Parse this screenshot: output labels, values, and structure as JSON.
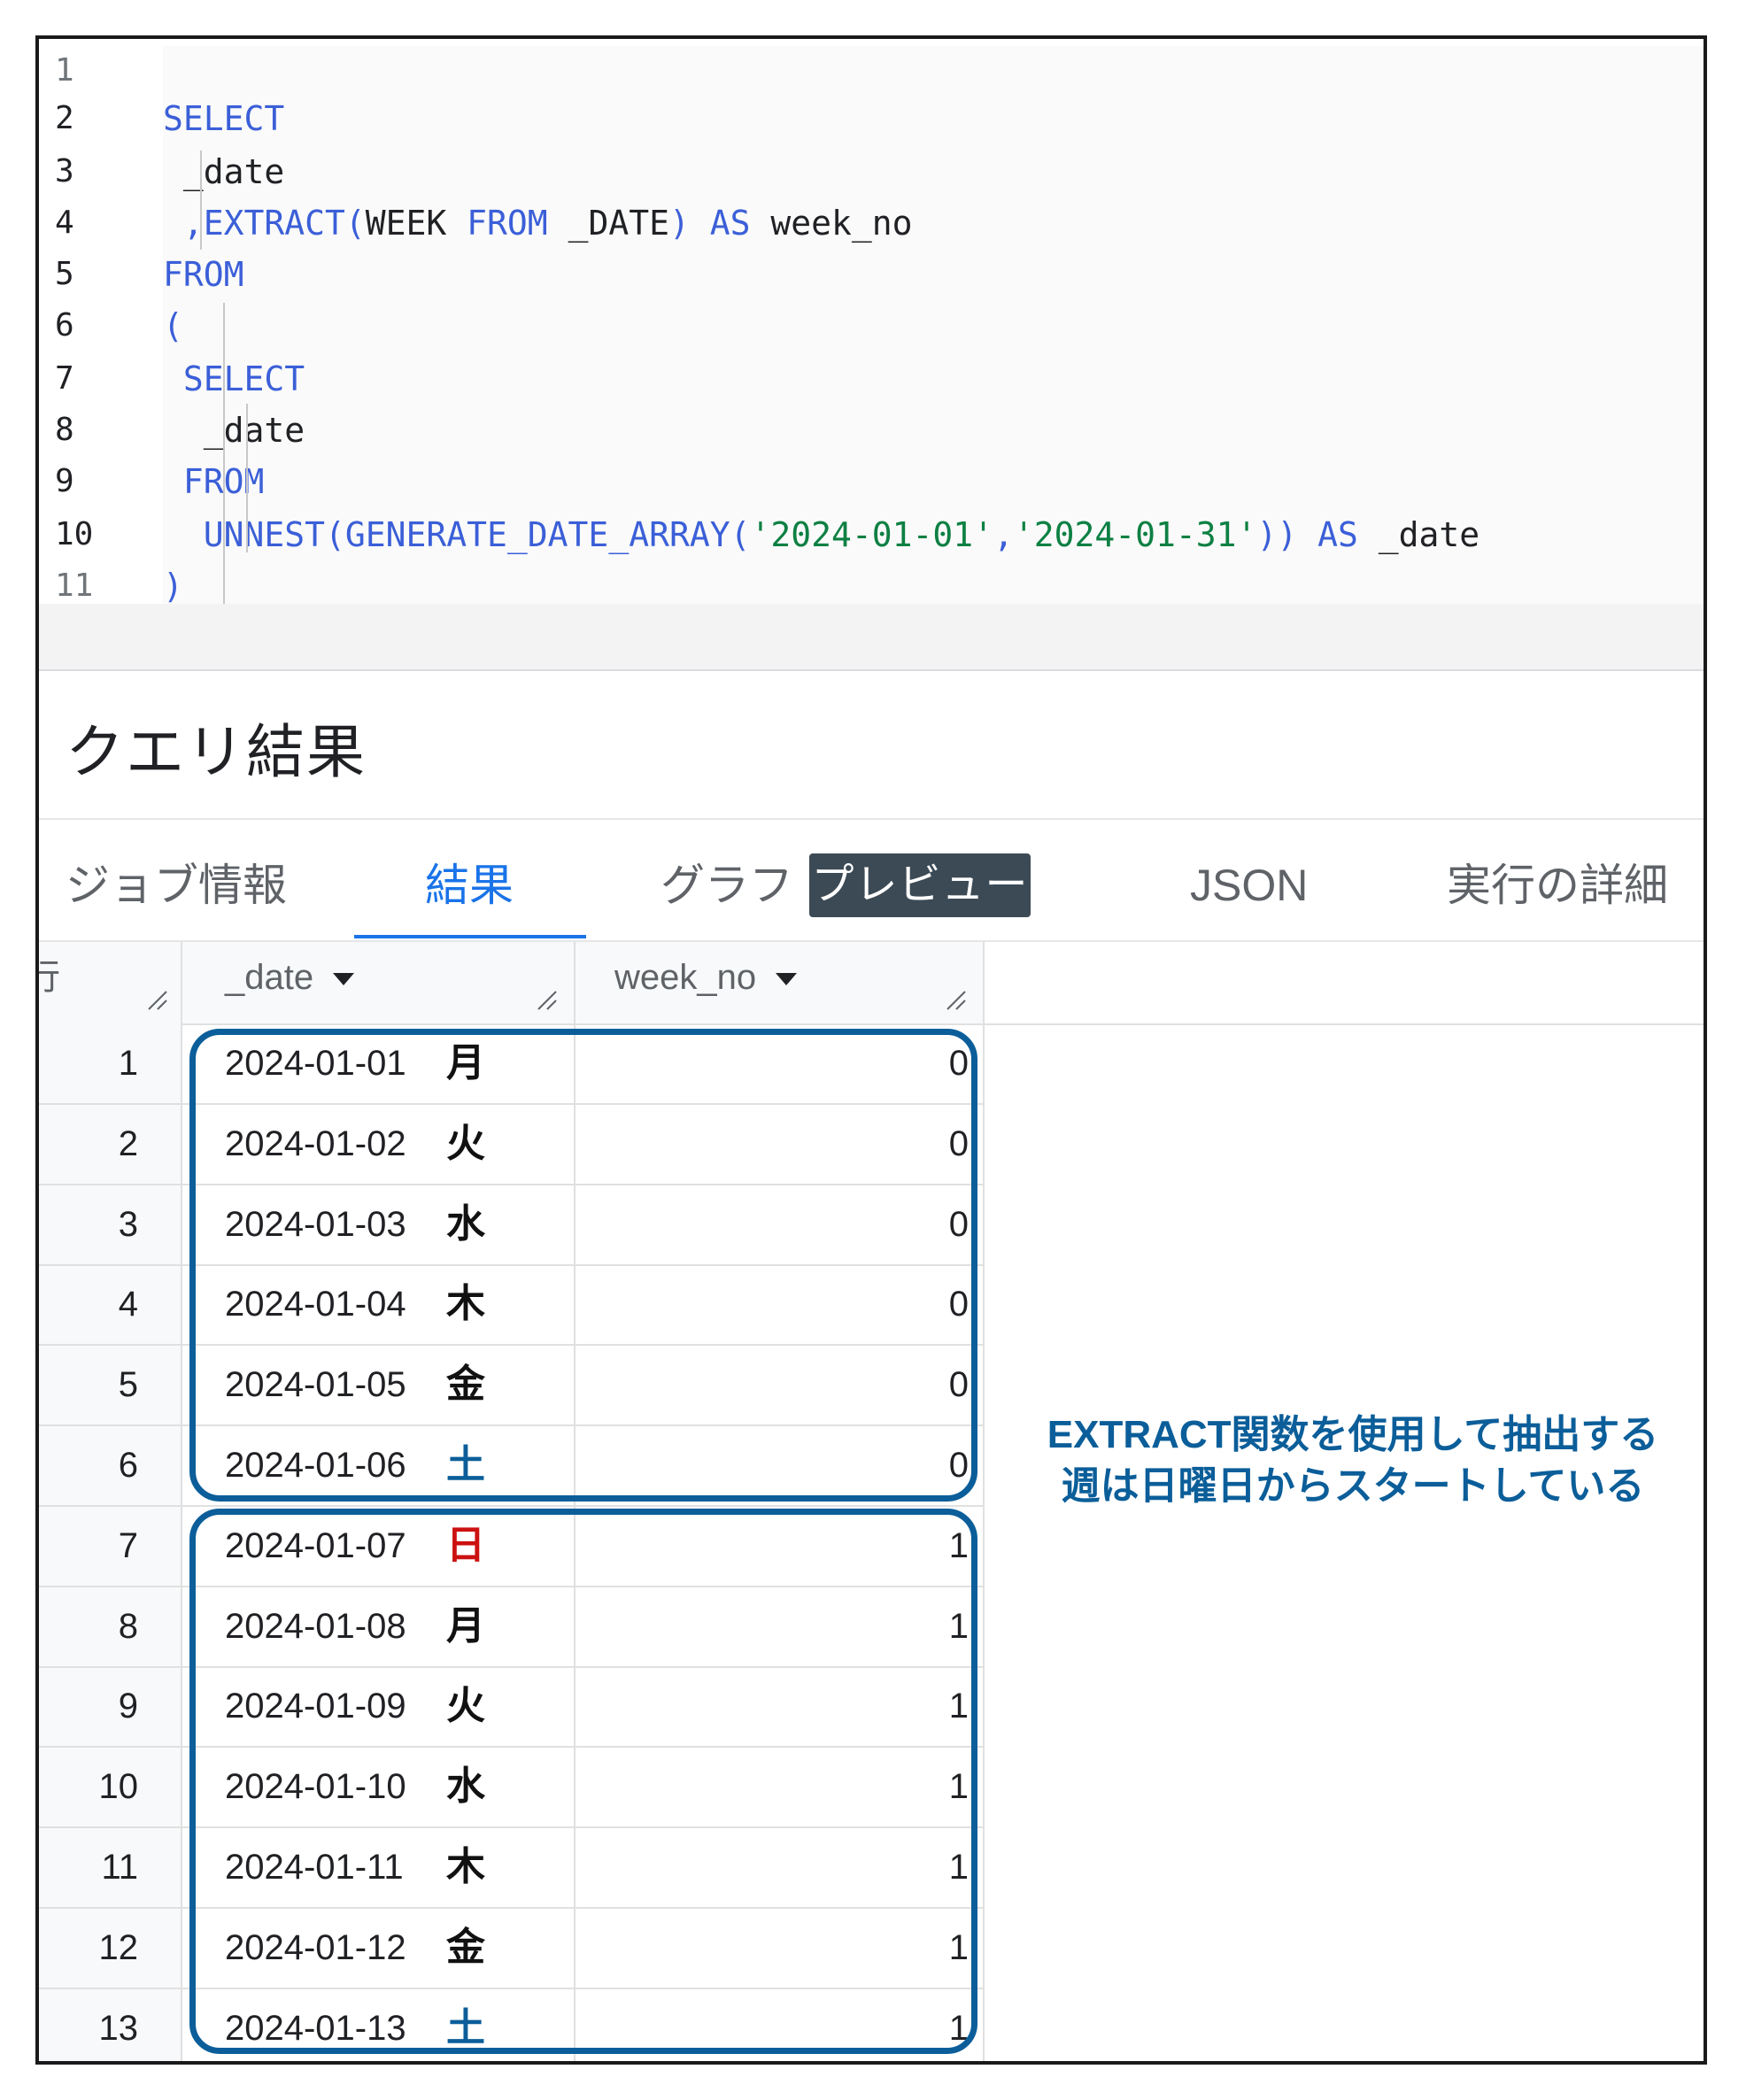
{
  "editor": {
    "lines": [
      {
        "n": "1",
        "tokens": []
      },
      {
        "n": "2",
        "tokens": [
          {
            "t": "SELECT",
            "c": "kw"
          }
        ]
      },
      {
        "n": "3",
        "tokens": [
          {
            "t": " _date",
            "c": "id"
          }
        ]
      },
      {
        "n": "4",
        "tokens": [
          {
            "t": " ,EXTRACT(",
            "c": "fn"
          },
          {
            "t": "WEEK ",
            "c": "id"
          },
          {
            "t": "FROM ",
            "c": "kw"
          },
          {
            "t": "_DATE",
            "c": "id"
          },
          {
            "t": ") ",
            "c": "pn"
          },
          {
            "t": "AS ",
            "c": "kw"
          },
          {
            "t": "week_no",
            "c": "id"
          }
        ]
      },
      {
        "n": "5",
        "tokens": [
          {
            "t": "FROM",
            "c": "kw"
          }
        ]
      },
      {
        "n": "6",
        "tokens": [
          {
            "t": "(",
            "c": "pn"
          }
        ]
      },
      {
        "n": "7",
        "tokens": [
          {
            "t": " SELECT",
            "c": "kw"
          }
        ]
      },
      {
        "n": "8",
        "tokens": [
          {
            "t": "  _date",
            "c": "id"
          }
        ]
      },
      {
        "n": "9",
        "tokens": [
          {
            "t": " FROM",
            "c": "kw"
          }
        ]
      },
      {
        "n": "10",
        "tokens": [
          {
            "t": "  UNNEST(GENERATE_DATE_ARRAY(",
            "c": "fn"
          },
          {
            "t": "'2024-01-01'",
            "c": "str"
          },
          {
            "t": ",",
            "c": "pn"
          },
          {
            "t": "'2024-01-31'",
            "c": "str"
          },
          {
            "t": ")) ",
            "c": "pn"
          },
          {
            "t": "AS ",
            "c": "kw"
          },
          {
            "t": "_date",
            "c": "id"
          }
        ]
      },
      {
        "n": "11",
        "tokens": [
          {
            "t": ")",
            "c": "pn"
          }
        ]
      }
    ]
  },
  "results": {
    "title": "クエリ結果",
    "tabs": [
      {
        "label": "ジョブ情報",
        "active": false
      },
      {
        "label": "結果",
        "active": true
      },
      {
        "label": "グラフ",
        "active": false
      },
      {
        "label": "JSON",
        "active": false
      },
      {
        "label": "実行の詳細",
        "active": false
      }
    ],
    "preview_chip": "プレビュー"
  },
  "table": {
    "columns": {
      "row": "行",
      "date": "_date",
      "week_no": "week_no"
    },
    "rows": [
      {
        "num": "1",
        "date": "2024-01-01",
        "dow": "月",
        "dow_color": "#111111",
        "week_no": "0"
      },
      {
        "num": "2",
        "date": "2024-01-02",
        "dow": "火",
        "dow_color": "#111111",
        "week_no": "0"
      },
      {
        "num": "3",
        "date": "2024-01-03",
        "dow": "水",
        "dow_color": "#111111",
        "week_no": "0"
      },
      {
        "num": "4",
        "date": "2024-01-04",
        "dow": "木",
        "dow_color": "#111111",
        "week_no": "0"
      },
      {
        "num": "5",
        "date": "2024-01-05",
        "dow": "金",
        "dow_color": "#111111",
        "week_no": "0"
      },
      {
        "num": "6",
        "date": "2024-01-06",
        "dow": "土",
        "dow_color": "#0b5e99",
        "week_no": "0"
      },
      {
        "num": "7",
        "date": "2024-01-07",
        "dow": "日",
        "dow_color": "#cc1111",
        "week_no": "1"
      },
      {
        "num": "8",
        "date": "2024-01-08",
        "dow": "月",
        "dow_color": "#111111",
        "week_no": "1"
      },
      {
        "num": "9",
        "date": "2024-01-09",
        "dow": "火",
        "dow_color": "#111111",
        "week_no": "1"
      },
      {
        "num": "10",
        "date": "2024-01-10",
        "dow": "水",
        "dow_color": "#111111",
        "week_no": "1"
      },
      {
        "num": "11",
        "date": "2024-01-11",
        "dow": "木",
        "dow_color": "#111111",
        "week_no": "1"
      },
      {
        "num": "12",
        "date": "2024-01-12",
        "dow": "金",
        "dow_color": "#111111",
        "week_no": "1"
      },
      {
        "num": "13",
        "date": "2024-01-13",
        "dow": "土",
        "dow_color": "#0b5e99",
        "week_no": "1"
      }
    ]
  },
  "annotation": {
    "line1": "EXTRACT関数を使用して抽出する",
    "line2": "週は日曜日からスタートしている",
    "color": "#0b5e99"
  }
}
